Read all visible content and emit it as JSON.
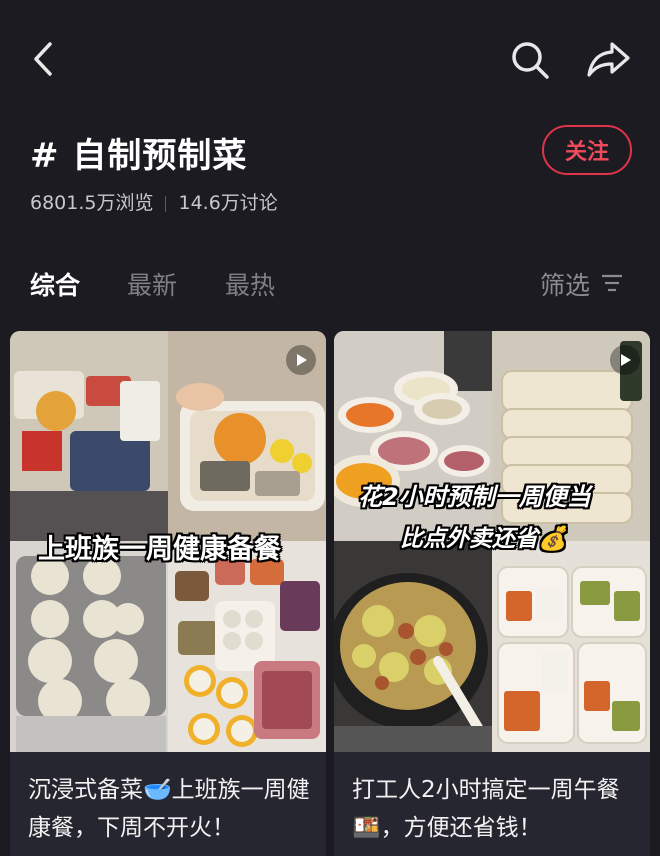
{
  "topic": {
    "title": "# 自制预制菜",
    "follow_label": "关注",
    "views": "6801.5万浏览",
    "discussions": "14.6万讨论"
  },
  "tabs": [
    "综合",
    "最新",
    "最热"
  ],
  "filter_label": "筛选",
  "cards": [
    {
      "overlay": "上班族一周健康备餐",
      "title_before": "沉浸式备菜",
      "title_after": "上班族一周健康餐，下周不开火！"
    },
    {
      "overlay_line1": "花2小时预制一周便当",
      "overlay_line2": "比点外卖还省",
      "title_before": "打工人2小时搞定一周午餐",
      "title_after": "，方便还省钱！"
    }
  ],
  "colors": {
    "background": "#1b1b21",
    "follow_accent": "#e0344a"
  },
  "icons": [
    "back-arrow-icon",
    "search-icon",
    "share-icon",
    "filter-icon",
    "play-icon",
    "salad-bowl-emoji",
    "bento-emoji",
    "money-bag-emoji"
  ]
}
